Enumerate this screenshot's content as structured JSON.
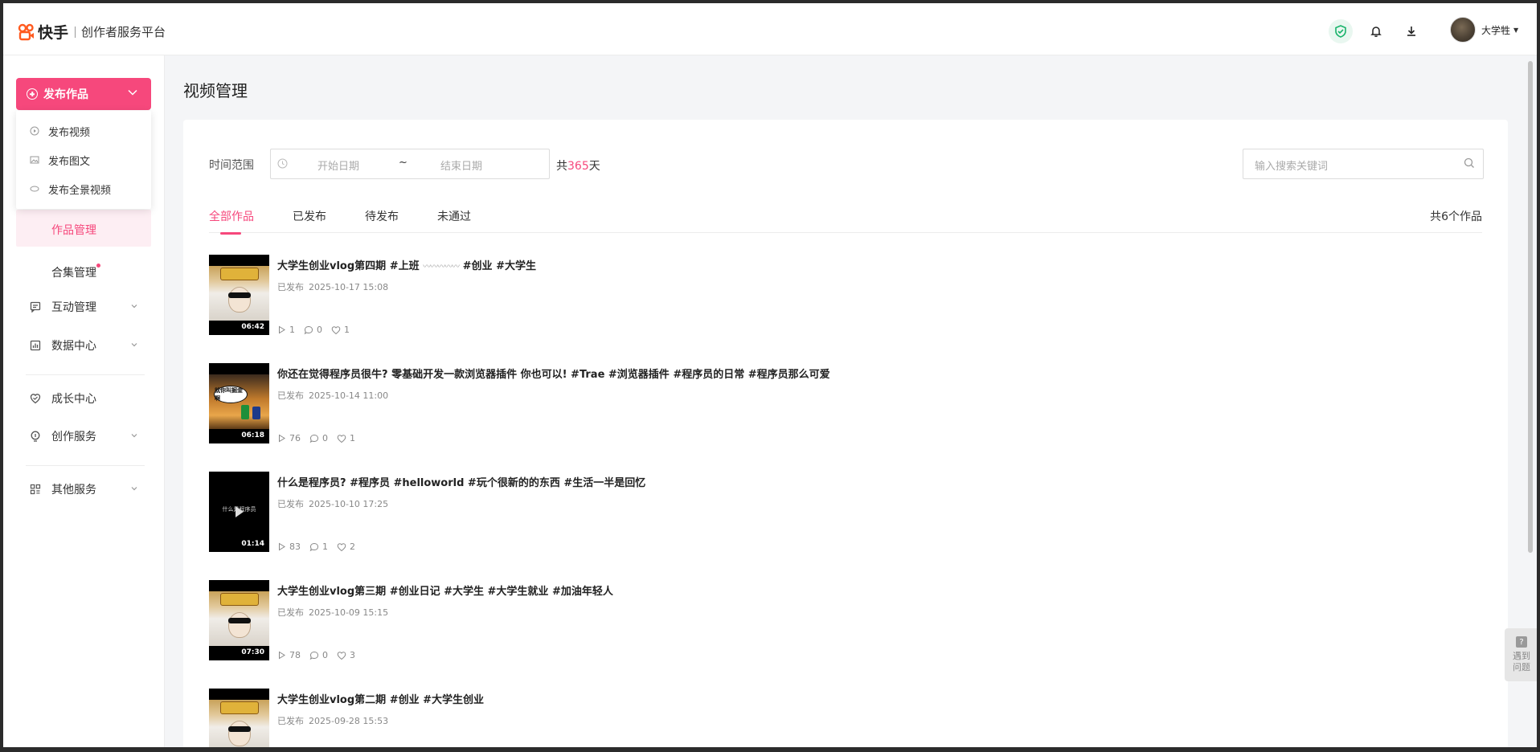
{
  "header": {
    "brand": "快手",
    "platform": "创作者服务平台",
    "username": "大学牲"
  },
  "sidebar": {
    "publish_label": "发布作品",
    "publish_menu": [
      "发布视频",
      "发布图文",
      "发布全景视频"
    ],
    "works_manage": "作品管理",
    "collection_manage": "合集管理",
    "interaction": "互动管理",
    "data_center": "数据中心",
    "growth": "成长中心",
    "creation_service": "创作服务",
    "other_service": "其他服务"
  },
  "main": {
    "page_title": "视频管理",
    "time_range_label": "时间范围",
    "start_placeholder": "开始日期",
    "end_placeholder": "结束日期",
    "range_sep": "~",
    "days_prefix": "共",
    "days_num": "365",
    "days_suffix": "天",
    "search_placeholder": "输入搜索关键词",
    "tabs": [
      "全部作品",
      "已发布",
      "待发布",
      "未通过"
    ],
    "total": "共6个作品"
  },
  "videos": [
    {
      "title": "大学生创业vlog第四期 #上班",
      "title_tail": " #创业 #大学生",
      "squiggle": "〰〰〰〰〰",
      "status": "已发布",
      "time": "2025-10-17 15:08",
      "duration": "06:42",
      "plays": "1",
      "comments": "0",
      "likes": "1"
    },
    {
      "title": "你还在觉得程序员很牛? 零基础开发一款浏览器插件 你也可以! #Trae #浏览器插件 #程序员的日常 #程序员那么可爱",
      "status": "已发布",
      "time": "2025-10-14 11:00",
      "duration": "06:18",
      "thumb_text": "就你叫掘金啊",
      "plays": "76",
      "comments": "0",
      "likes": "1"
    },
    {
      "title": "什么是程序员? #程序员 #helloworld #玩个很新的的东西 #生活一半是回忆",
      "status": "已发布",
      "time": "2025-10-10 17:25",
      "duration": "01:14",
      "thumb_text": "什么是程序员",
      "plays": "83",
      "comments": "1",
      "likes": "2"
    },
    {
      "title": "大学生创业vlog第三期 #创业日记 #大学生 #大学生就业 #加油年轻人",
      "status": "已发布",
      "time": "2025-10-09 15:15",
      "duration": "07:30",
      "plays": "78",
      "comments": "0",
      "likes": "3"
    },
    {
      "title": "大学生创业vlog第二期 #创业 #大学生创业",
      "status": "已发布",
      "time": "2025-09-28 15:53"
    }
  ],
  "help": {
    "line1": "遇到",
    "line2": "问题"
  },
  "colors": {
    "accent": "#f6487c",
    "brand_orange": "#ff5a1f"
  }
}
